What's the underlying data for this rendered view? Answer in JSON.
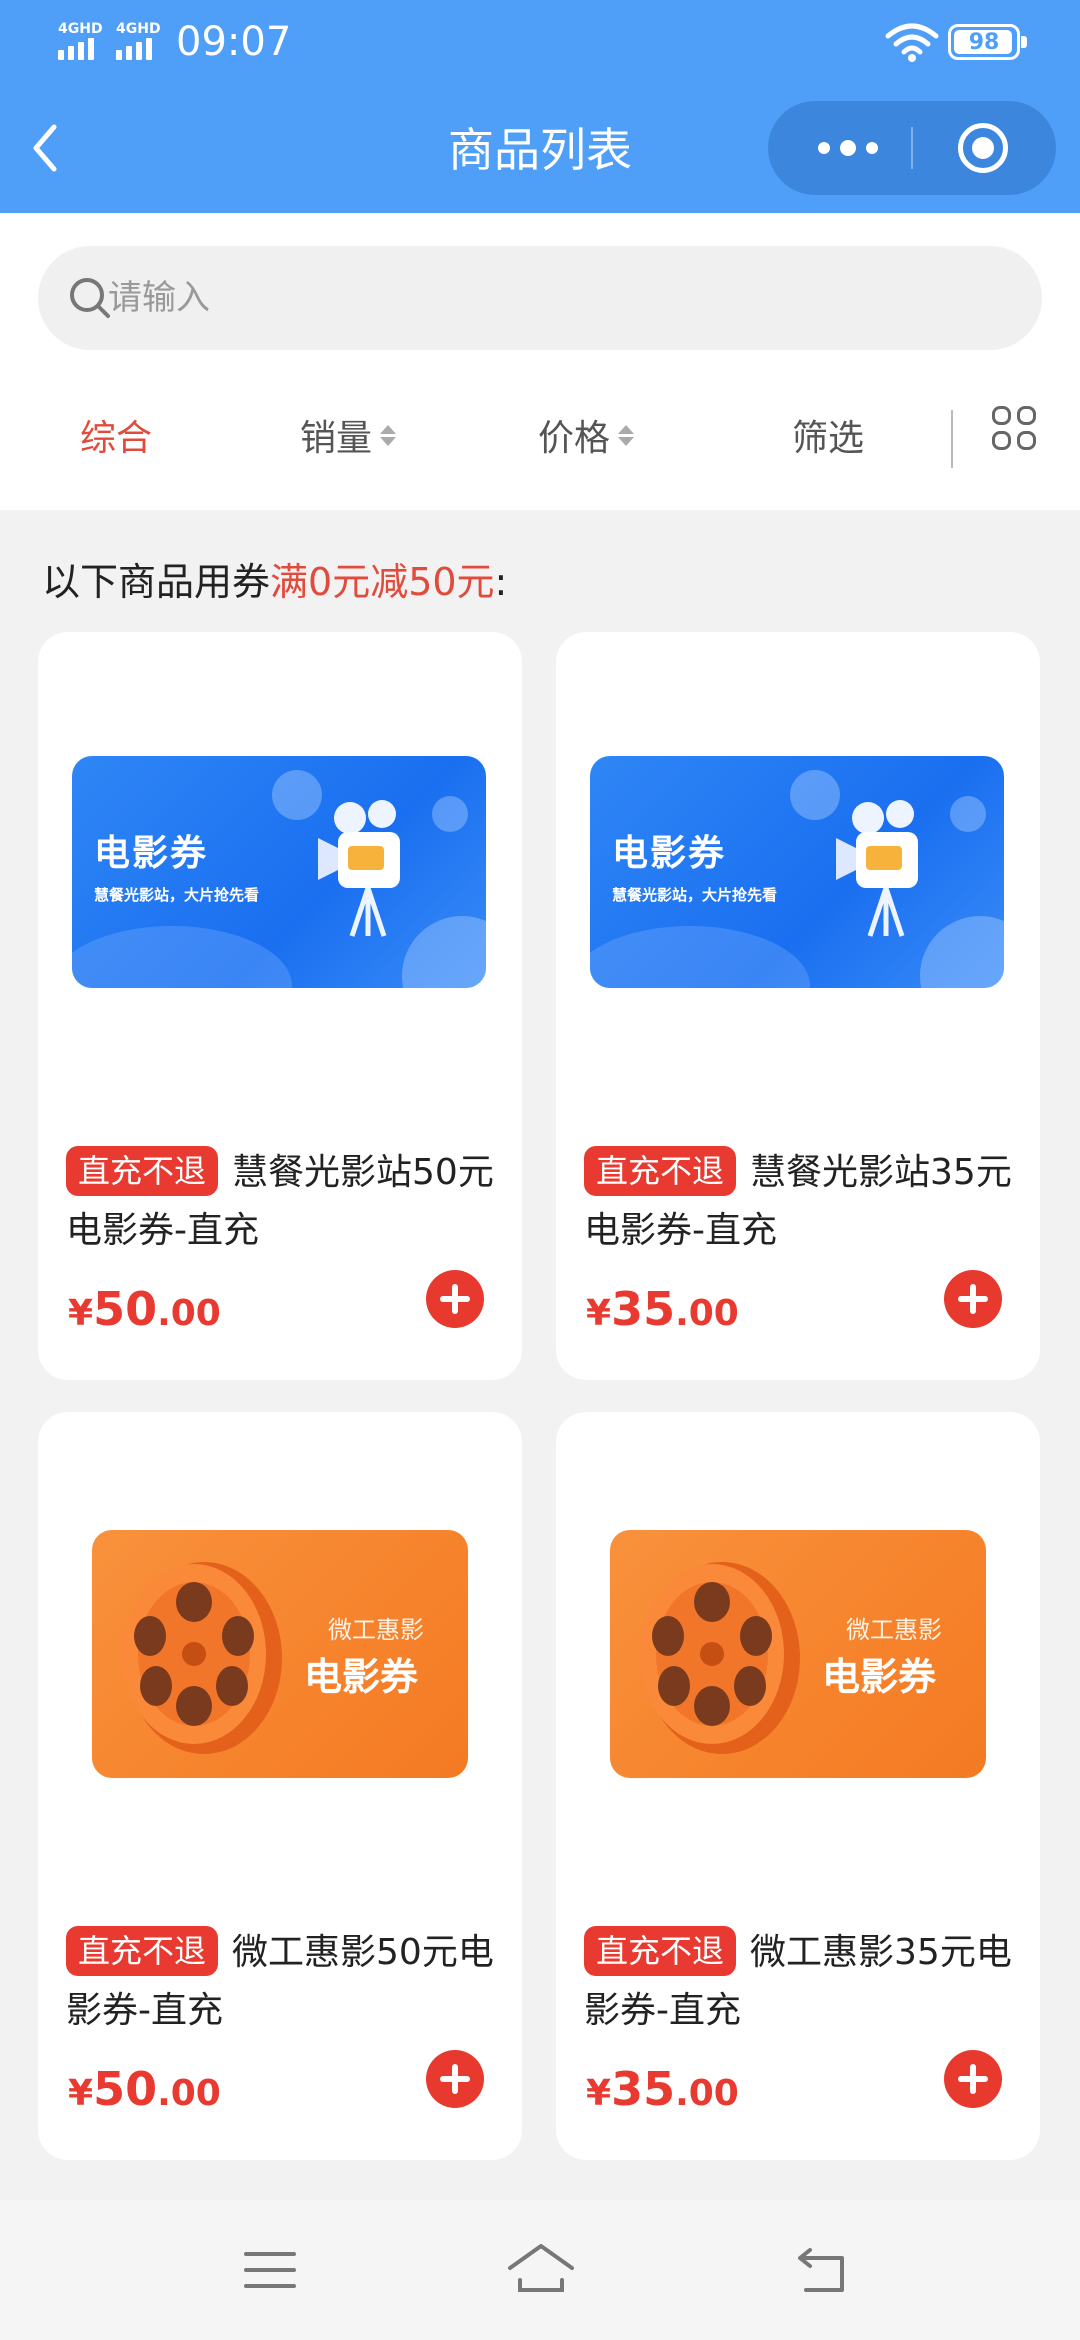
{
  "status_bar": {
    "signal1": "4GHD",
    "signal2": "4GHD",
    "time": "09:07",
    "battery": "98"
  },
  "nav": {
    "title": "商品列表"
  },
  "search": {
    "placeholder": "请输入"
  },
  "filters": [
    {
      "label": "综合",
      "active": true
    },
    {
      "label": "销量",
      "sortable": true
    },
    {
      "label": "价格",
      "sortable": true
    },
    {
      "label": "筛选"
    }
  ],
  "notice": {
    "prefix": "以下商品用券",
    "highlight": "满0元减50元",
    "suffix": ":"
  },
  "products": [
    {
      "badge": "直充不退",
      "name": "慧餐光影站50元电影券-直充",
      "price_symbol": "¥",
      "price_int": "50",
      "price_dec": ".00",
      "banner": {
        "title": "电影券",
        "subtitle": "慧餐光影站，大片抢先看"
      }
    },
    {
      "badge": "直充不退",
      "name": "慧餐光影站35元电影券-直充",
      "price_symbol": "¥",
      "price_int": "35",
      "price_dec": ".00",
      "banner": {
        "title": "电影券",
        "subtitle": "慧餐光影站，大片抢先看"
      }
    },
    {
      "badge": "直充不退",
      "name": "微工惠影50元电影券-直充",
      "price_symbol": "¥",
      "price_int": "50",
      "price_dec": ".00",
      "banner": {
        "title": "电影券",
        "subtitle": "微工惠影"
      }
    },
    {
      "badge": "直充不退",
      "name": "微工惠影35元电影券-直充",
      "price_symbol": "¥",
      "price_int": "35",
      "price_dec": ".00",
      "banner": {
        "title": "电影券",
        "subtitle": "微工惠影"
      }
    }
  ],
  "colors": {
    "header_bg": "#4f9ff8",
    "accent_red": "#e83a30",
    "active_tab": "#e14b3c"
  },
  "icons": [
    "back-icon",
    "more-icon",
    "target-icon",
    "search-icon",
    "sort-icon",
    "grid-view-icon",
    "add-cart-icon",
    "menu-icon",
    "home-icon",
    "back-nav-icon"
  ]
}
